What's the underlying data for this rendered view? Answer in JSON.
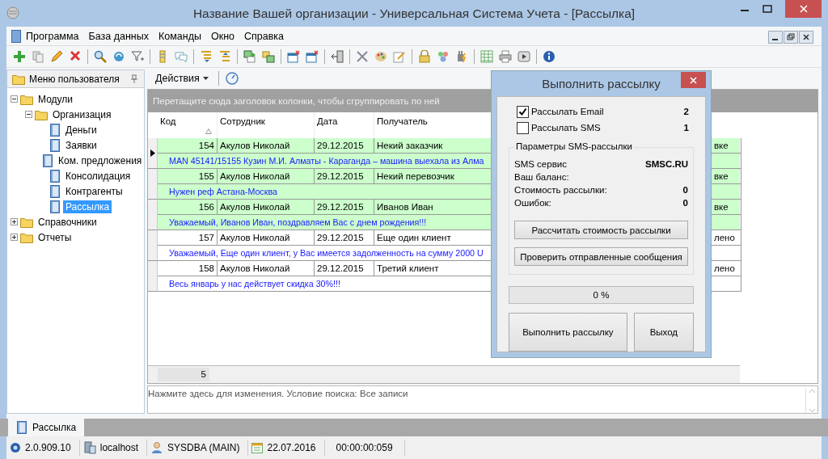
{
  "window": {
    "title": "Название Вашей организации - Универсальная Система Учета - [Рассылка]"
  },
  "menu": [
    "Программа",
    "База данных",
    "Команды",
    "Окно",
    "Справка"
  ],
  "side_panel": {
    "title": "Меню пользователя",
    "tree": [
      {
        "label": "Модули",
        "kind": "folder",
        "expanded": true,
        "selected": false,
        "children": [
          {
            "label": "Организация",
            "kind": "folder",
            "expanded": true,
            "selected": false,
            "children": [
              {
                "label": "Деньги",
                "kind": "document",
                "selected": false
              },
              {
                "label": "Заявки",
                "kind": "document",
                "selected": false
              },
              {
                "label": "Ком. предложения",
                "kind": "document",
                "selected": false
              },
              {
                "label": "Консолидация",
                "kind": "document",
                "selected": false
              },
              {
                "label": "Контрагенты",
                "kind": "document",
                "selected": false
              },
              {
                "label": "Рассылка",
                "kind": "document",
                "selected": true
              }
            ]
          }
        ]
      },
      {
        "label": "Справочники",
        "kind": "folder",
        "expanded": false,
        "selected": false
      },
      {
        "label": "Отчеты",
        "kind": "folder",
        "expanded": false,
        "selected": false
      }
    ]
  },
  "actions_button": "Действия",
  "group_hint": "Перетащите сюда заголовок колонки, чтобы сгруппировать по ней",
  "table": {
    "columns": [
      "Код",
      "Сотрудник",
      "Дата",
      "Получатель"
    ],
    "rows": [
      {
        "code": "154",
        "employee": "Акулов Николай",
        "date": "29.12.2015",
        "recipient": "Некий заказчик",
        "column_5": "вке",
        "note": "MAN 45141/15155 Кузин М.И. Алматы - Караганда – машина выехала из Алма",
        "highlighted": true,
        "selected": true
      },
      {
        "code": "155",
        "employee": "Акулов Николай",
        "date": "29.12.2015",
        "recipient": "Некий перевозчик",
        "column_5": "вке",
        "note": "Нужен реф Астана-Москва",
        "highlighted": true,
        "selected": false
      },
      {
        "code": "156",
        "employee": "Акулов Николай",
        "date": "29.12.2015",
        "recipient": "Иванов Иван",
        "column_5": "вке",
        "note": "Уважаемый, Иванов Иван, поздравляем Вас с днем рождения!!!",
        "highlighted": true,
        "selected": false
      },
      {
        "code": "157",
        "employee": "Акулов Николай",
        "date": "29.12.2015",
        "recipient": "Еще один клиент",
        "column_5": "лено",
        "note": "Уважаемый, Еще один клиент, у Вас имеется задолженность на сумму 2000 U",
        "highlighted": false,
        "selected": false
      },
      {
        "code": "158",
        "employee": "Акулов Николай",
        "date": "29.12.2015",
        "recipient": "Третий клиент",
        "column_5": "лено",
        "note": "Весь январь у нас действует скидка 30%!!!",
        "highlighted": false,
        "selected": false
      }
    ],
    "footer_count": "5"
  },
  "filter_bar": "Нажмите здесь для изменения. Условие поиска: Все записи",
  "document_tabs": [
    {
      "label": "Рассылка",
      "selected": true
    }
  ],
  "status_bar": {
    "version": "2.0.909.10",
    "host": "localhost",
    "user": "SYSDBA (MAIN)",
    "date": "22.07.2016",
    "timer": "00:00:00:059"
  },
  "dialog": {
    "title": "Выполнить рассылку",
    "options": [
      {
        "label": "Рассылать Email",
        "checked": true,
        "count": "2"
      },
      {
        "label": "Рассылать SMS",
        "checked": false,
        "count": "1"
      }
    ],
    "sms_group": {
      "title": "Параметры SMS-рассылки",
      "fields": [
        {
          "label": "SMS сервис",
          "value": "SMSC.RU"
        },
        {
          "label": "Ваш баланс:"
        },
        {
          "label": "Стоимость рассылки:",
          "value": "0"
        },
        {
          "label": "Ошибок:",
          "value": "0"
        }
      ],
      "buttons": [
        "Рассчитать стоимость рассылки",
        "Проверить отправленные сообщения"
      ]
    },
    "progress": {
      "level": 0,
      "reading": "0 %"
    },
    "buttons": [
      "Выполнить рассылку",
      "Выход"
    ]
  }
}
